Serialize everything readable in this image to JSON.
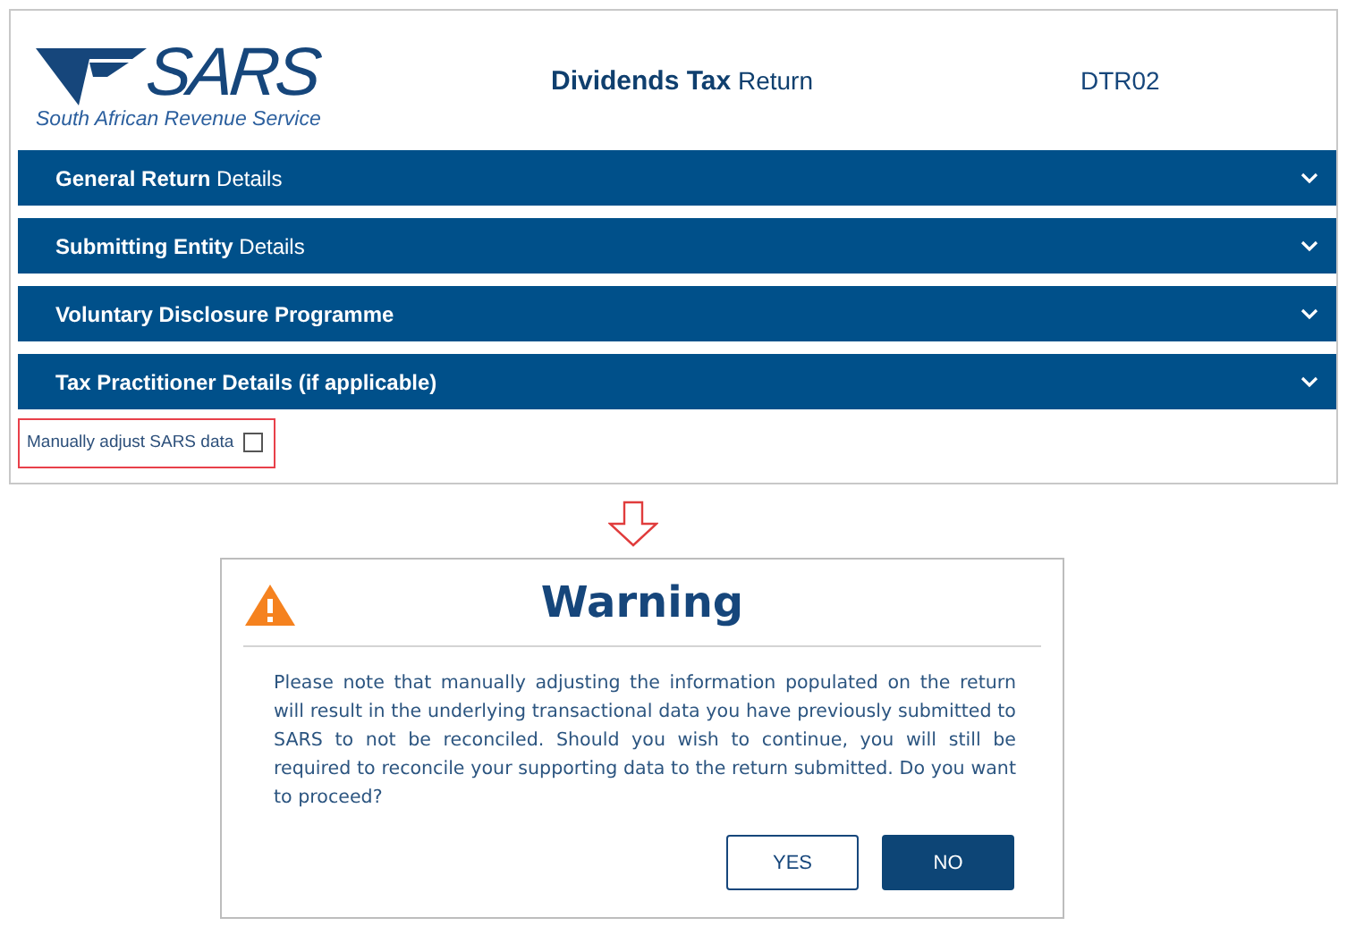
{
  "header": {
    "logo_word": "SARS",
    "logo_caption": "South African Revenue Service",
    "title": "**Dividends Tax** Return",
    "form_code": "DTR02"
  },
  "sections": [
    {
      "bold": "General Return",
      "plain": "Details",
      "expanded": false
    },
    {
      "bold": "Submitting Entity",
      "plain": "Details",
      "expanded": false
    },
    {
      "bold": "Voluntary Disclosure Programme",
      "expanded": false
    },
    {
      "bold": "Tax Practitioner Details (if applicable)",
      "expanded": false
    }
  ],
  "manual_adjust": {
    "label": "Manually adjust SARS data",
    "checked": false
  },
  "dialog": {
    "title": "Warning",
    "message": "Please note that manually adjusting the information populated on the return will result in the underlying transactional data you have previously submitted to SARS to not be reconciled. Should you wish to continue, you will still be required to reconcile your supporting data to the return submitted. Do you want to proceed?",
    "buttons": [
      {
        "label": "YES",
        "kind": "secondary"
      },
      {
        "label": "NO",
        "kind": "primary"
      }
    ]
  }
}
